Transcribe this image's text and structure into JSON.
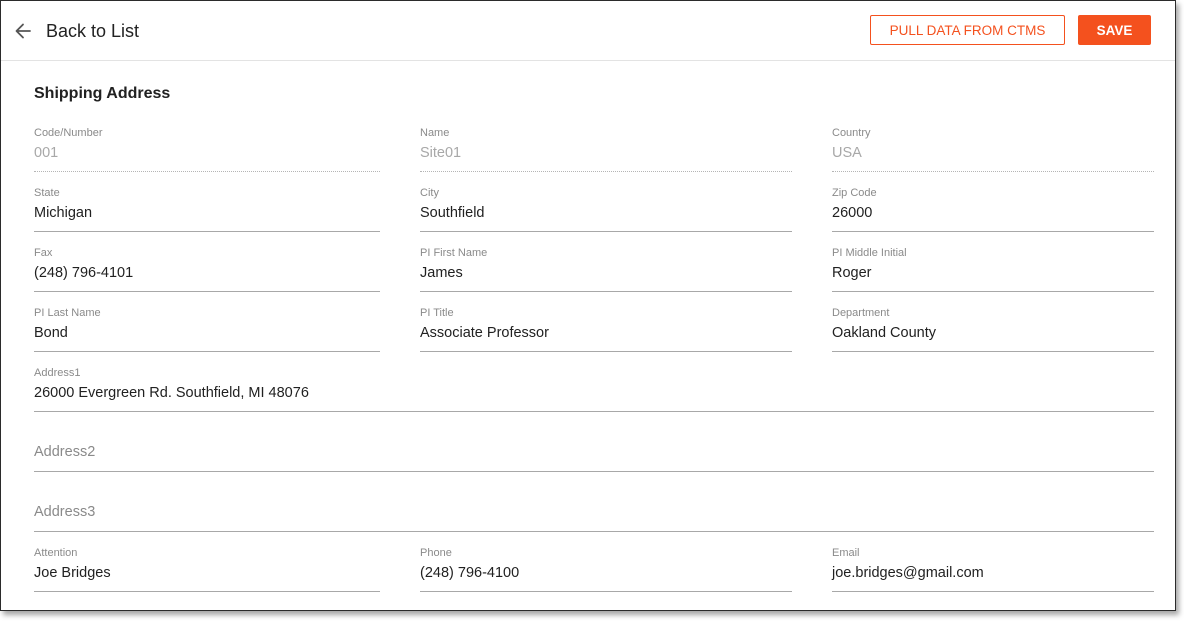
{
  "header": {
    "back_label": "Back to List",
    "pull_button": "PULL DATA FROM CTMS",
    "save_button": "SAVE"
  },
  "section_title": "Shipping Address",
  "colors": {
    "accent": "#f4511e"
  },
  "fields": {
    "code": {
      "label": "Code/Number",
      "value": "001"
    },
    "name": {
      "label": "Name",
      "value": "Site01"
    },
    "country": {
      "label": "Country",
      "value": "USA"
    },
    "state": {
      "label": "State",
      "value": "Michigan"
    },
    "city": {
      "label": "City",
      "value": "Southfield"
    },
    "zip": {
      "label": "Zip Code",
      "value": "26000"
    },
    "fax": {
      "label": "Fax",
      "value": "(248) 796-4101"
    },
    "pi_first": {
      "label": "PI First Name",
      "value": "James"
    },
    "pi_middle": {
      "label": "PI Middle Initial",
      "value": "Roger"
    },
    "pi_last": {
      "label": "PI Last Name",
      "value": "Bond"
    },
    "pi_title": {
      "label": "PI Title",
      "value": "Associate Professor"
    },
    "department": {
      "label": "Department",
      "value": "Oakland County"
    },
    "address1": {
      "label": "Address1",
      "value": "26000 Evergreen Rd. Southfield, MI 48076"
    },
    "address2": {
      "placeholder": "Address2"
    },
    "address3": {
      "placeholder": "Address3"
    },
    "attention": {
      "label": "Attention",
      "value": "Joe Bridges"
    },
    "phone": {
      "label": "Phone",
      "value": "(248) 796-4100"
    },
    "email": {
      "label": "Email",
      "value": "joe.bridges@gmail.com"
    }
  }
}
